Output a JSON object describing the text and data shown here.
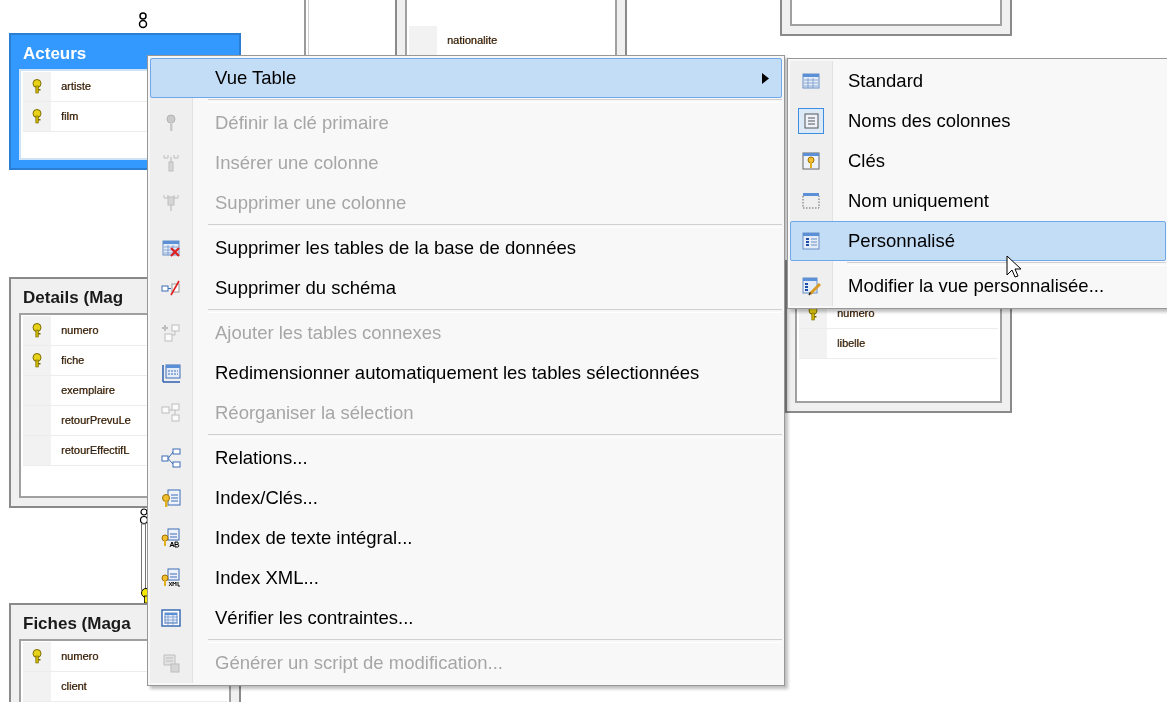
{
  "tables": [
    {
      "title": "Acteurs",
      "selected": true,
      "columns": [
        {
          "name": "artiste",
          "key": true
        },
        {
          "name": "film",
          "key": true
        }
      ]
    },
    {
      "selected": false,
      "columns": [
        {
          "name": "nationalite",
          "key": false
        }
      ]
    },
    {
      "selected": false
    },
    {
      "title": "Details (Mag",
      "selected": false,
      "columns": [
        {
          "name": "numero",
          "key": true
        },
        {
          "name": "fiche",
          "key": true
        },
        {
          "name": "exemplaire",
          "key": false
        },
        {
          "name": "retourPrevuLe",
          "key": false
        },
        {
          "name": "retourEffectifL",
          "key": false
        }
      ]
    },
    {
      "selected": false,
      "columns": [
        {
          "name": "numero",
          "key": true
        },
        {
          "name": "libelle",
          "key": false
        }
      ]
    },
    {
      "title": "Fiches (Maga",
      "selected": false,
      "columns": [
        {
          "name": "numero",
          "key": true
        },
        {
          "name": "client",
          "key": false
        }
      ]
    }
  ],
  "context_menu": {
    "items": [
      {
        "kind": "submenu",
        "label": "Vue Table",
        "disabled": false,
        "selected": true
      },
      {
        "kind": "separator"
      },
      {
        "kind": "item",
        "label": "Définir la clé primaire",
        "disabled": true,
        "selected": false
      },
      {
        "kind": "item",
        "label": "Insérer une colonne",
        "disabled": true,
        "selected": false
      },
      {
        "kind": "item",
        "label": "Supprimer une colonne",
        "disabled": true,
        "selected": false
      },
      {
        "kind": "separator"
      },
      {
        "kind": "item",
        "label": "Supprimer les tables de la base de données",
        "disabled": false,
        "selected": false
      },
      {
        "kind": "item",
        "label": "Supprimer du schéma",
        "disabled": false,
        "selected": false
      },
      {
        "kind": "separator"
      },
      {
        "kind": "item",
        "label": "Ajouter les tables connexes",
        "disabled": true,
        "selected": false
      },
      {
        "kind": "item",
        "label": "Redimensionner automatiquement les tables sélectionnées",
        "disabled": false,
        "selected": false
      },
      {
        "kind": "item",
        "label": "Réorganiser la sélection",
        "disabled": true,
        "selected": false
      },
      {
        "kind": "separator"
      },
      {
        "kind": "item",
        "label": "Relations...",
        "disabled": false,
        "selected": false
      },
      {
        "kind": "item",
        "label": "Index/Clés...",
        "disabled": false,
        "selected": false
      },
      {
        "kind": "item",
        "label": "Index de texte intégral...",
        "disabled": false,
        "selected": false
      },
      {
        "kind": "item",
        "label": "Index XML...",
        "disabled": false,
        "selected": false
      },
      {
        "kind": "item",
        "label": "Vérifier les contraintes...",
        "disabled": false,
        "selected": false
      },
      {
        "kind": "separator"
      },
      {
        "kind": "item",
        "label": "Générer un script de modification...",
        "disabled": true,
        "selected": false
      }
    ]
  },
  "submenu": {
    "items": [
      {
        "kind": "item",
        "label": "Standard",
        "checked": false,
        "selected": false
      },
      {
        "kind": "item",
        "label": "Noms des colonnes",
        "checked": true,
        "selected": false
      },
      {
        "kind": "item",
        "label": "Clés",
        "checked": false,
        "selected": false
      },
      {
        "kind": "item",
        "label": "Nom uniquement",
        "checked": false,
        "selected": false
      },
      {
        "kind": "item",
        "label": "Personnalisé",
        "checked": false,
        "selected": true
      },
      {
        "kind": "separator"
      },
      {
        "kind": "item",
        "label": "Modifier la vue personnalisée...",
        "checked": false,
        "selected": false
      }
    ]
  }
}
